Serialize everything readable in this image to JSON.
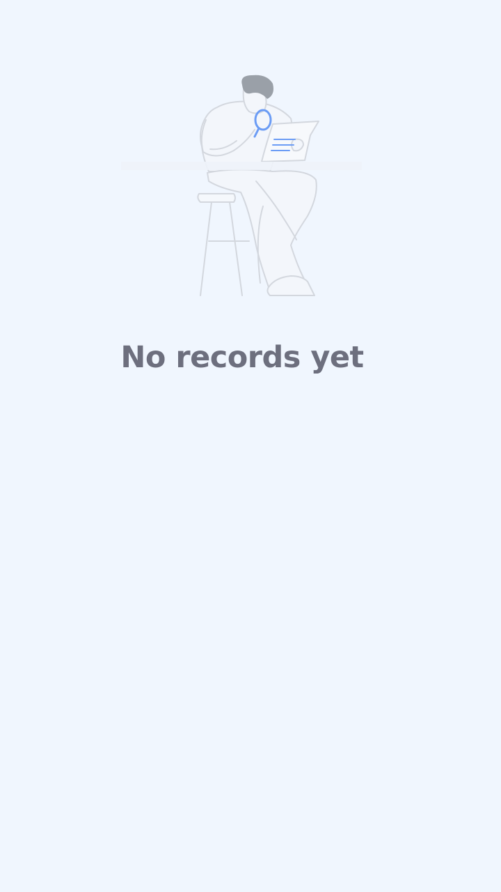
{
  "empty_state": {
    "title": "No records yet",
    "illustration": "person-reading-document-with-magnifier-icon"
  },
  "colors": {
    "background": "#f0f6fe",
    "title_text": "#6d6f7e",
    "line_art": "#d3d7de",
    "accent": "#6b9cf5",
    "hair": "#9aa0a8"
  }
}
